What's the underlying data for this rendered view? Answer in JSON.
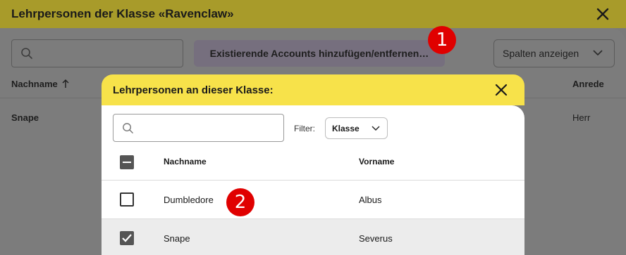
{
  "outer_dialog": {
    "title": "Lehrpersonen der Klasse «Ravenclaw»",
    "search": {
      "placeholder": "",
      "value": ""
    },
    "add_button_label": "Existierende Accounts hinzufügen/entfernen…",
    "columns_button_label": "Spalten anzeigen",
    "columns": [
      {
        "label": "Nachname",
        "sort": "ascending"
      },
      {
        "label": "Anrede"
      }
    ],
    "rows": [
      {
        "nachname": "Snape",
        "anrede": "Herr"
      }
    ]
  },
  "markers": [
    "1",
    "2"
  ],
  "inner_dialog": {
    "title": "Lehrpersonen an dieser Klasse:",
    "search": {
      "placeholder": "",
      "value": ""
    },
    "filter": {
      "label": "Filter:",
      "selected": "Klasse"
    },
    "columns": {
      "nachname": "Nachname",
      "vorname": "Vorname"
    },
    "header_checkbox_state": "indeterminate",
    "rows": [
      {
        "nachname": "Dumbledore",
        "vorname": "Albus",
        "checked": false
      },
      {
        "nachname": "Snape",
        "vorname": "Severus",
        "checked": true
      }
    ]
  },
  "colors": {
    "outer_header": "#a89b2a",
    "inner_header": "#f7e24a",
    "marker": "#e00000",
    "overlay": "#7c7c7c"
  },
  "icons": [
    "close-icon",
    "search-icon",
    "chevron-down-icon",
    "sort-up-arrow-icon",
    "checkmark-icon"
  ]
}
